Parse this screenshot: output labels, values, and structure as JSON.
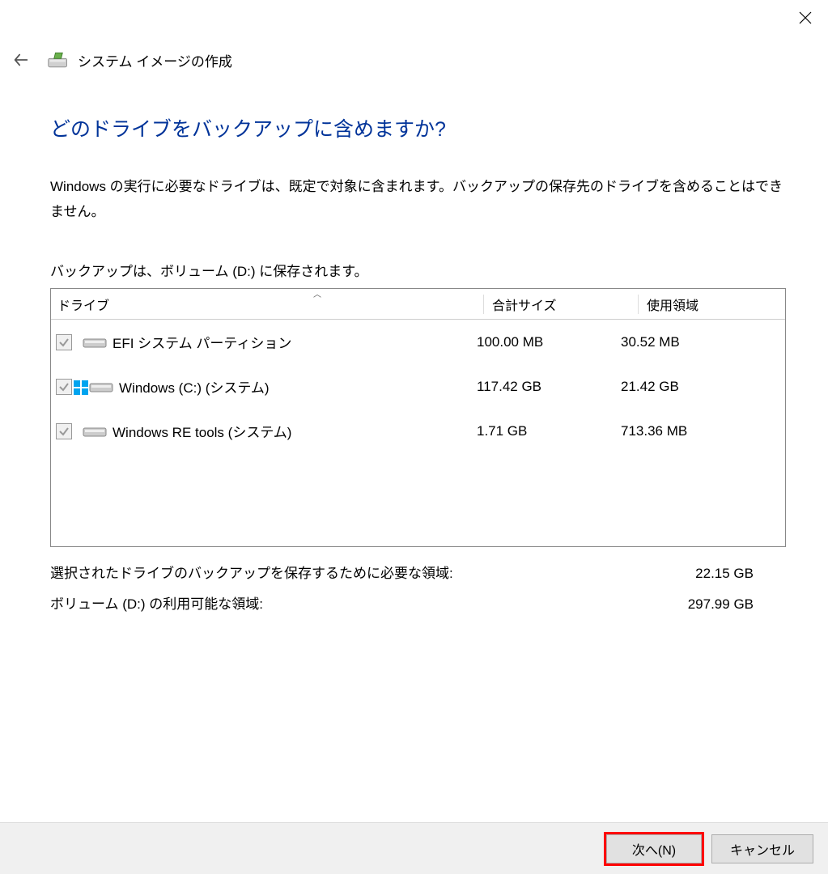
{
  "window": {
    "title": "システム イメージの作成"
  },
  "main": {
    "headline": "どのドライブをバックアップに含めますか?",
    "description": "Windows の実行に必要なドライブは、既定で対象に含まれます。バックアップの保存先のドライブを含めることはできません。",
    "save_note": "バックアップは、ボリューム (D:) に保存されます。"
  },
  "table": {
    "headers": {
      "drive": "ドライブ",
      "total": "合計サイズ",
      "used": "使用領域"
    },
    "rows": [
      {
        "label": "EFI システム パーティション",
        "total": "100.00 MB",
        "used": "30.52 MB",
        "overlay": false
      },
      {
        "label": "Windows (C:) (システム)",
        "total": "117.42 GB",
        "used": "21.42 GB",
        "overlay": true
      },
      {
        "label": "Windows RE tools (システム)",
        "total": "1.71 GB",
        "used": "713.36 MB",
        "overlay": false
      }
    ]
  },
  "summary": {
    "required_label": "選択されたドライブのバックアップを保存するために必要な領域:",
    "required_value": "22.15 GB",
    "available_label": "ボリューム (D:) の利用可能な領域:",
    "available_value": "297.99 GB"
  },
  "footer": {
    "next": "次へ(N)",
    "cancel": "キャンセル"
  }
}
